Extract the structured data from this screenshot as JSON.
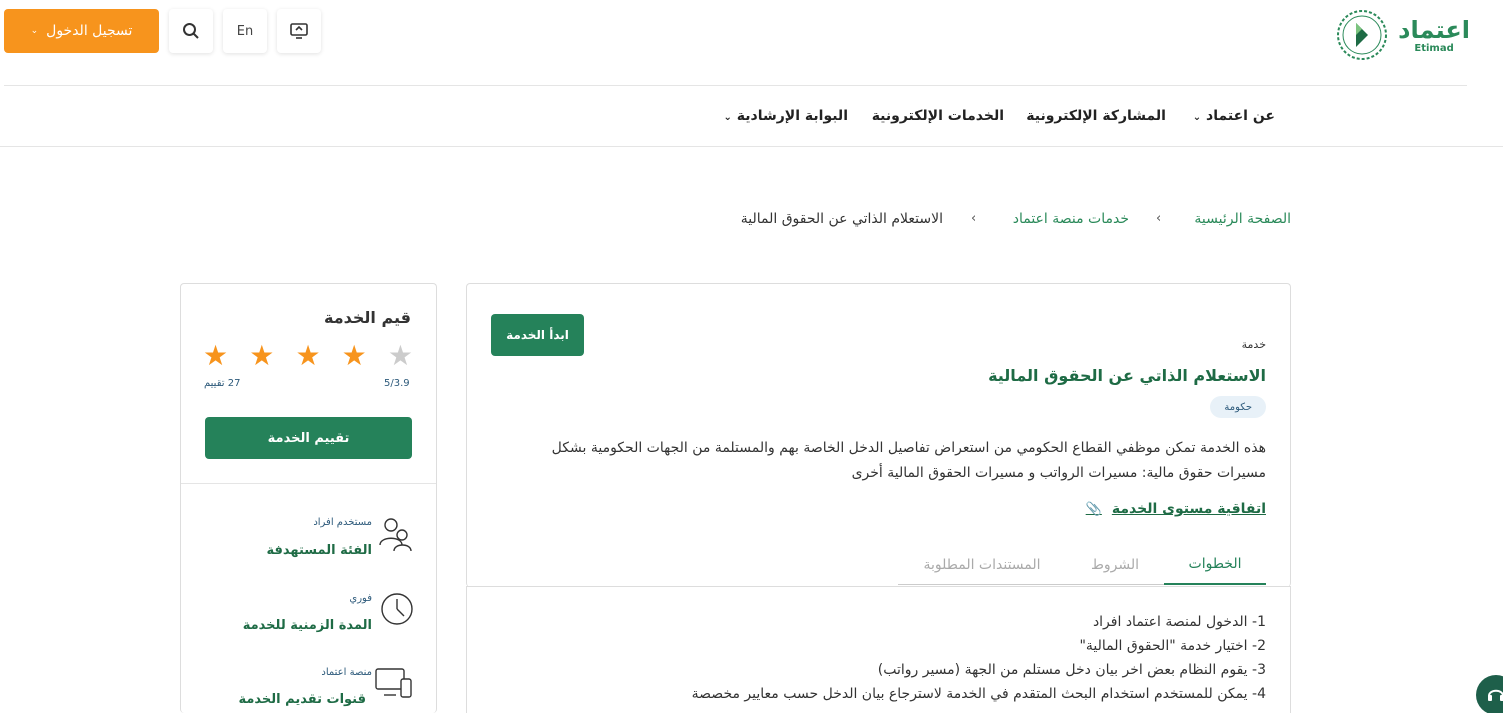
{
  "header": {
    "logo_ar": "اعتماد",
    "logo_en": "Etimad",
    "login_label": "تسجيل الدخول",
    "lang_label": "En"
  },
  "nav": {
    "items": [
      {
        "label": "عن اعتماد"
      },
      {
        "label": "المشاركة الإلكترونية"
      },
      {
        "label": "الخدمات الإلكترونية"
      },
      {
        "label": "البوابة الإرشادية"
      }
    ]
  },
  "breadcrumb": {
    "home": "الصفحة الرئيسية",
    "services": "خدمات منصة اعتماد",
    "current": "الاستعلام الذاتي عن الحقوق المالية"
  },
  "service": {
    "start_label": "ابدأ الخدمة",
    "kind": "خدمة",
    "title": "الاستعلام الذاتي عن الحقوق المالية",
    "tag": "حكومة",
    "description": "هذه الخدمة تمكن موظفي القطاع الحكومي من استعراض تفاصيل الدخل الخاصة بهم والمستلمة من الجهات الحكومية بشكل مسيرات حقوق مالية: مسيرات الرواتب و مسيرات الحقوق المالية أخرى",
    "sla_label": "اتفاقية مستوى الخدمة"
  },
  "tabs": [
    {
      "label": "الخطوات",
      "active": true
    },
    {
      "label": "الشروط",
      "active": false
    },
    {
      "label": "المستندات المطلوبة",
      "active": false
    }
  ],
  "steps": [
    "1- الدخول لمنصة اعتماد افراد",
    "2- اختيار خدمة \"الحقوق المالية\"",
    "3- يقوم النظام بعض اخر بيان دخل مستلم من الجهة (مسير رواتب)",
    "4- يمكن للمستخدم استخدام البحث المتقدم في الخدمة لاسترجاع بيان الدخل حسب معايير مخصصة"
  ],
  "rating": {
    "title": "قيم الخدمة",
    "score": 3.9,
    "stars_filled": 4,
    "stars_total": 5,
    "score_label": "5/3.9",
    "count_label": "27 تقييم",
    "button_label": "تقييم الخدمة"
  },
  "meta": {
    "audience_value": "مستخدم افراد",
    "audience_label": "الفئة المستهدفة",
    "duration_value": "فوري",
    "duration_label": "المدة الزمنية للخدمة",
    "channel_value": "منصة اعتماد",
    "channel_label": "قنوات تقديم الخدمة"
  },
  "colors": {
    "primary_green": "#25825a",
    "accent_orange": "#f7941d",
    "title_green": "#1e6b45"
  }
}
